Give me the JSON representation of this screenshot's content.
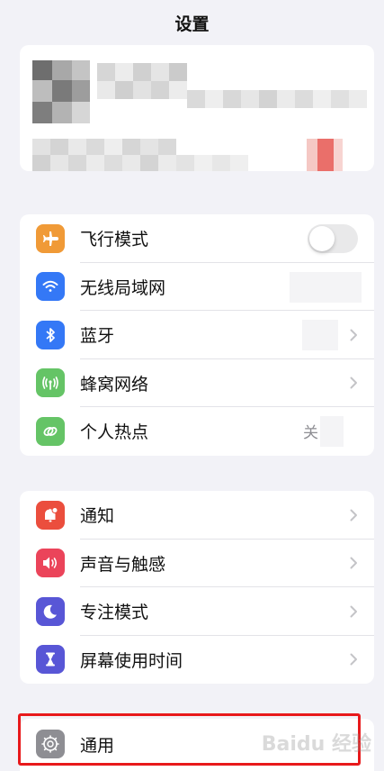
{
  "nav": {
    "title": "设置"
  },
  "section_network": [
    {
      "label": "飞行模式",
      "icon": "airplane-icon",
      "color": "#f09a37",
      "accessory": "toggle",
      "toggle_on": false
    },
    {
      "label": "无线局域网",
      "icon": "wifi-icon",
      "color": "#3478f6",
      "accessory": "value",
      "value": ""
    },
    {
      "label": "蓝牙",
      "icon": "bluetooth-icon",
      "color": "#3478f6",
      "accessory": "chevron",
      "value": ""
    },
    {
      "label": "蜂窝网络",
      "icon": "cellular-icon",
      "color": "#65c466",
      "accessory": "chevron"
    },
    {
      "label": "个人热点",
      "icon": "hotspot-icon",
      "color": "#65c466",
      "accessory": "value",
      "value": "关"
    }
  ],
  "section_notifications": [
    {
      "label": "通知",
      "icon": "notification-bell-icon",
      "color": "#eb4e3d"
    },
    {
      "label": "声音与触感",
      "icon": "speaker-icon",
      "color": "#eb445a"
    },
    {
      "label": "专注模式",
      "icon": "moon-icon",
      "color": "#5856d6"
    },
    {
      "label": "屏幕使用时间",
      "icon": "hourglass-icon",
      "color": "#5856d6"
    }
  ],
  "section_general": [
    {
      "label": "通用",
      "icon": "gear-icon",
      "color": "#8e8e93"
    }
  ],
  "watermark": "Baidu 经验"
}
